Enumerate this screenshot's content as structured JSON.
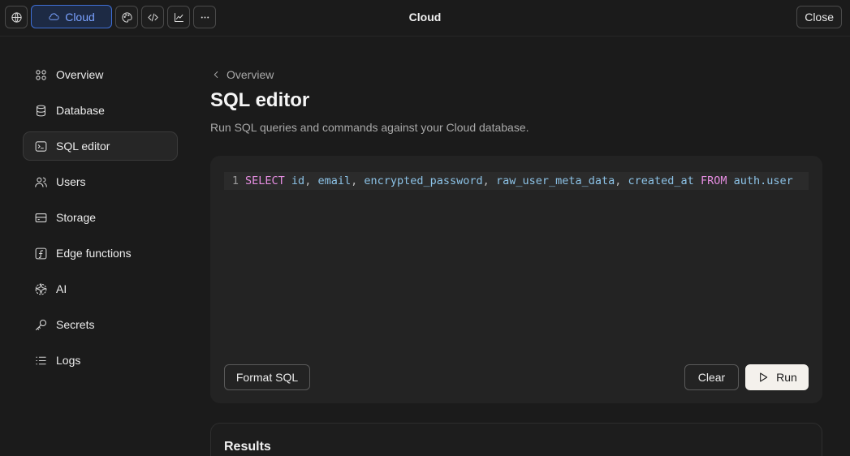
{
  "topbar": {
    "title": "Cloud",
    "cloud_label": "Cloud",
    "close_label": "Close",
    "icons": [
      "globe-icon",
      "palette-icon",
      "code-icon",
      "chart-icon",
      "more-icon"
    ]
  },
  "sidebar": {
    "items": [
      {
        "label": "Overview",
        "icon": "grid-icon"
      },
      {
        "label": "Database",
        "icon": "database-icon"
      },
      {
        "label": "SQL editor",
        "icon": "terminal-icon",
        "active": true
      },
      {
        "label": "Users",
        "icon": "users-icon"
      },
      {
        "label": "Storage",
        "icon": "storage-icon"
      },
      {
        "label": "Edge functions",
        "icon": "function-icon"
      },
      {
        "label": "AI",
        "icon": "sparkle-icon"
      },
      {
        "label": "Secrets",
        "icon": "key-icon"
      },
      {
        "label": "Logs",
        "icon": "list-icon"
      }
    ]
  },
  "main": {
    "breadcrumb": "Overview",
    "title": "SQL editor",
    "description": "Run SQL queries and commands against your Cloud database.",
    "editor": {
      "line_number": "1",
      "tokens": {
        "select": "SELECT",
        "id": "id",
        "email": "email",
        "encrypted_password": "encrypted_password",
        "raw_user_meta_data": "raw_user_meta_data",
        "created_at": "created_at",
        "from": "FROM",
        "table": "auth.user"
      }
    },
    "format_label": "Format SQL",
    "clear_label": "Clear",
    "run_label": "Run",
    "results_title": "Results"
  },
  "colors": {
    "accent": "#3f6fd6",
    "background": "#1b1b1b",
    "keyword": "#e58de0",
    "identifier": "#8cc2e6"
  }
}
